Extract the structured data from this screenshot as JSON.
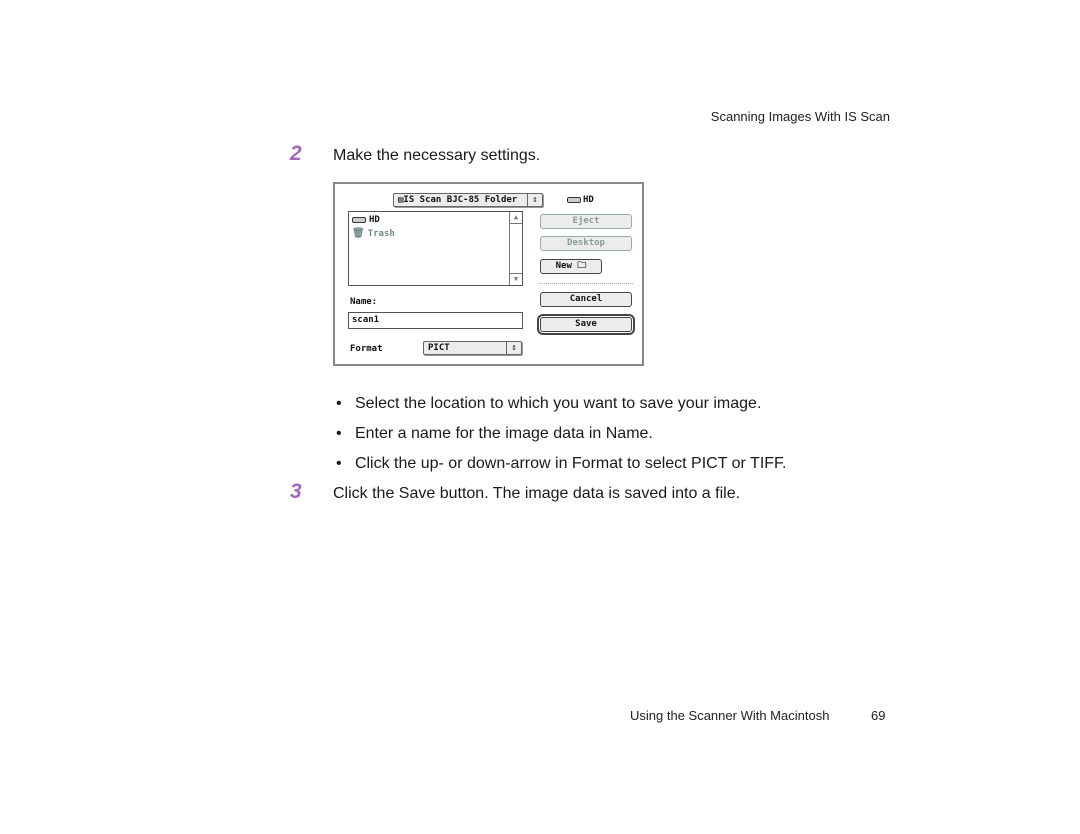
{
  "page": {
    "header": "Scanning Images With IS Scan",
    "footer_title": "Using the Scanner With Macintosh",
    "page_number": "69",
    "accent_color": "#a066c0"
  },
  "steps": [
    {
      "number": "2",
      "text": "Make the necessary settings."
    },
    {
      "number": "3",
      "text": "Click the Save button. The image data is saved into a file."
    }
  ],
  "bullets": [
    "Select the location to which you want to save your image.",
    "Enter a name for the image data in Name.",
    "Click the up- or down-arrow in Format to select PICT or TIFF."
  ],
  "dialog": {
    "folder_popup": "IS Scan BJC-85 Folder",
    "volume_label": "HD",
    "list_items": [
      {
        "label": "HD",
        "icon": "hard-disk-icon"
      },
      {
        "label": "Trash",
        "icon": "trash-icon"
      }
    ],
    "buttons": {
      "eject": "Eject",
      "desktop": "Desktop",
      "new": "New",
      "cancel": "Cancel",
      "save": "Save"
    },
    "name_label": "Name:",
    "name_value": "scan1",
    "format_label": "Format",
    "format_value": "PICT"
  }
}
